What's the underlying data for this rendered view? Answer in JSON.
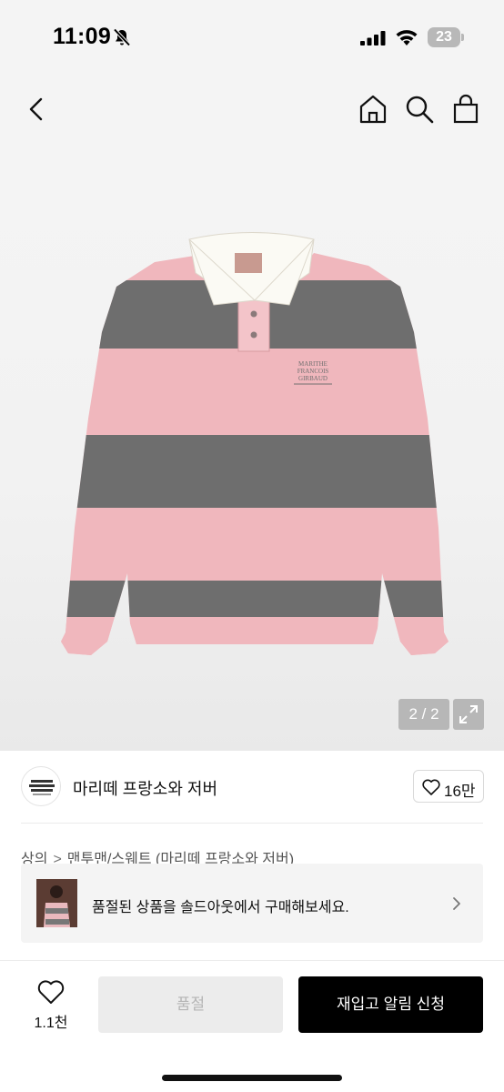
{
  "status_bar": {
    "time": "11:09",
    "battery": "23"
  },
  "header": {
    "icons": [
      "back-icon",
      "home-icon",
      "search-icon",
      "bag-icon"
    ]
  },
  "gallery": {
    "counter": "2 / 2",
    "colors": {
      "pink": "#f0b7bd",
      "gray": "#6e6e6e",
      "collar": "#fbfaf4"
    }
  },
  "brand": {
    "name": "마리떼 프랑소와 저버",
    "like_count": "16만",
    "logo_text": "MARITHE FRANCOIS GIRBAUD"
  },
  "breadcrumb": {
    "items": [
      "상의",
      "맨투맨/스웨트 (마리떼 프랑소와 저버)"
    ],
    "separator": ">"
  },
  "soldout_banner": {
    "text": "품절된 상품을 솔드아웃에서 구매해보세요."
  },
  "bottom_bar": {
    "wish_count": "1.1천",
    "soldout_label": "품절",
    "restock_label": "재입고 알림 신청",
    "accent": "#000000"
  }
}
